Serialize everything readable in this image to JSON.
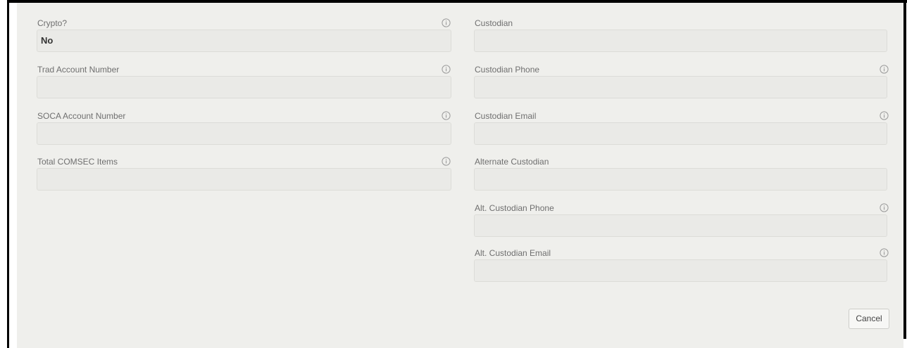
{
  "form": {
    "left": {
      "crypto": {
        "label": "Crypto?",
        "value": "No"
      },
      "trad_account_number": {
        "label": "Trad Account Number",
        "value": ""
      },
      "soca_account_number": {
        "label": "SOCA Account Number",
        "value": ""
      },
      "total_comsec_items": {
        "label": "Total COMSEC Items",
        "value": ""
      }
    },
    "right": {
      "custodian": {
        "label": "Custodian",
        "value": ""
      },
      "custodian_phone": {
        "label": "Custodian Phone",
        "value": ""
      },
      "custodian_email": {
        "label": "Custodian Email",
        "value": ""
      },
      "alternate_custodian": {
        "label": "Alternate Custodian",
        "value": ""
      },
      "alt_custodian_phone": {
        "label": "Alt. Custodian Phone",
        "value": ""
      },
      "alt_custodian_email": {
        "label": "Alt. Custodian Email",
        "value": ""
      }
    },
    "icons": {
      "info": "info-circle-icon"
    }
  },
  "actions": {
    "cancel_label": "Cancel"
  },
  "colors": {
    "frame": "#000000",
    "panel_background": "#efefec",
    "field_background": "#eaeae7",
    "field_border": "#dcdcd8",
    "label_text": "#6f6f6f",
    "value_text": "#333333"
  }
}
